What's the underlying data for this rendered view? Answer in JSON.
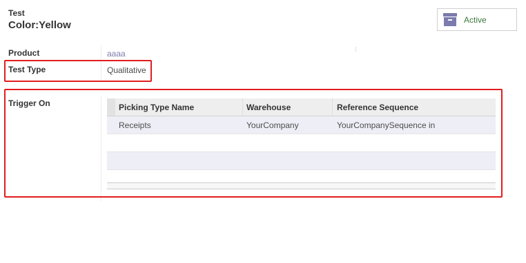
{
  "header": {
    "record_kind": "Test",
    "record_name": "Color:Yellow"
  },
  "active_toggle": {
    "label": "Active",
    "icon": "archive-icon"
  },
  "fields": {
    "product": {
      "label": "Product",
      "value": "aaaa"
    },
    "test_type": {
      "label": "Test Type",
      "value": "Qualitative"
    },
    "trigger_on": {
      "label": "Trigger On"
    }
  },
  "trigger_table": {
    "columns": [
      "Picking Type Name",
      "Warehouse",
      "Reference Sequence"
    ],
    "rows": [
      [
        "Receipts",
        "YourCompany",
        "YourCompanySequence in"
      ]
    ]
  },
  "colors": {
    "highlight": "#e21c1c",
    "link": "#7c7bad",
    "active_green": "#3c763d",
    "odd_row": "#eeeef7"
  }
}
